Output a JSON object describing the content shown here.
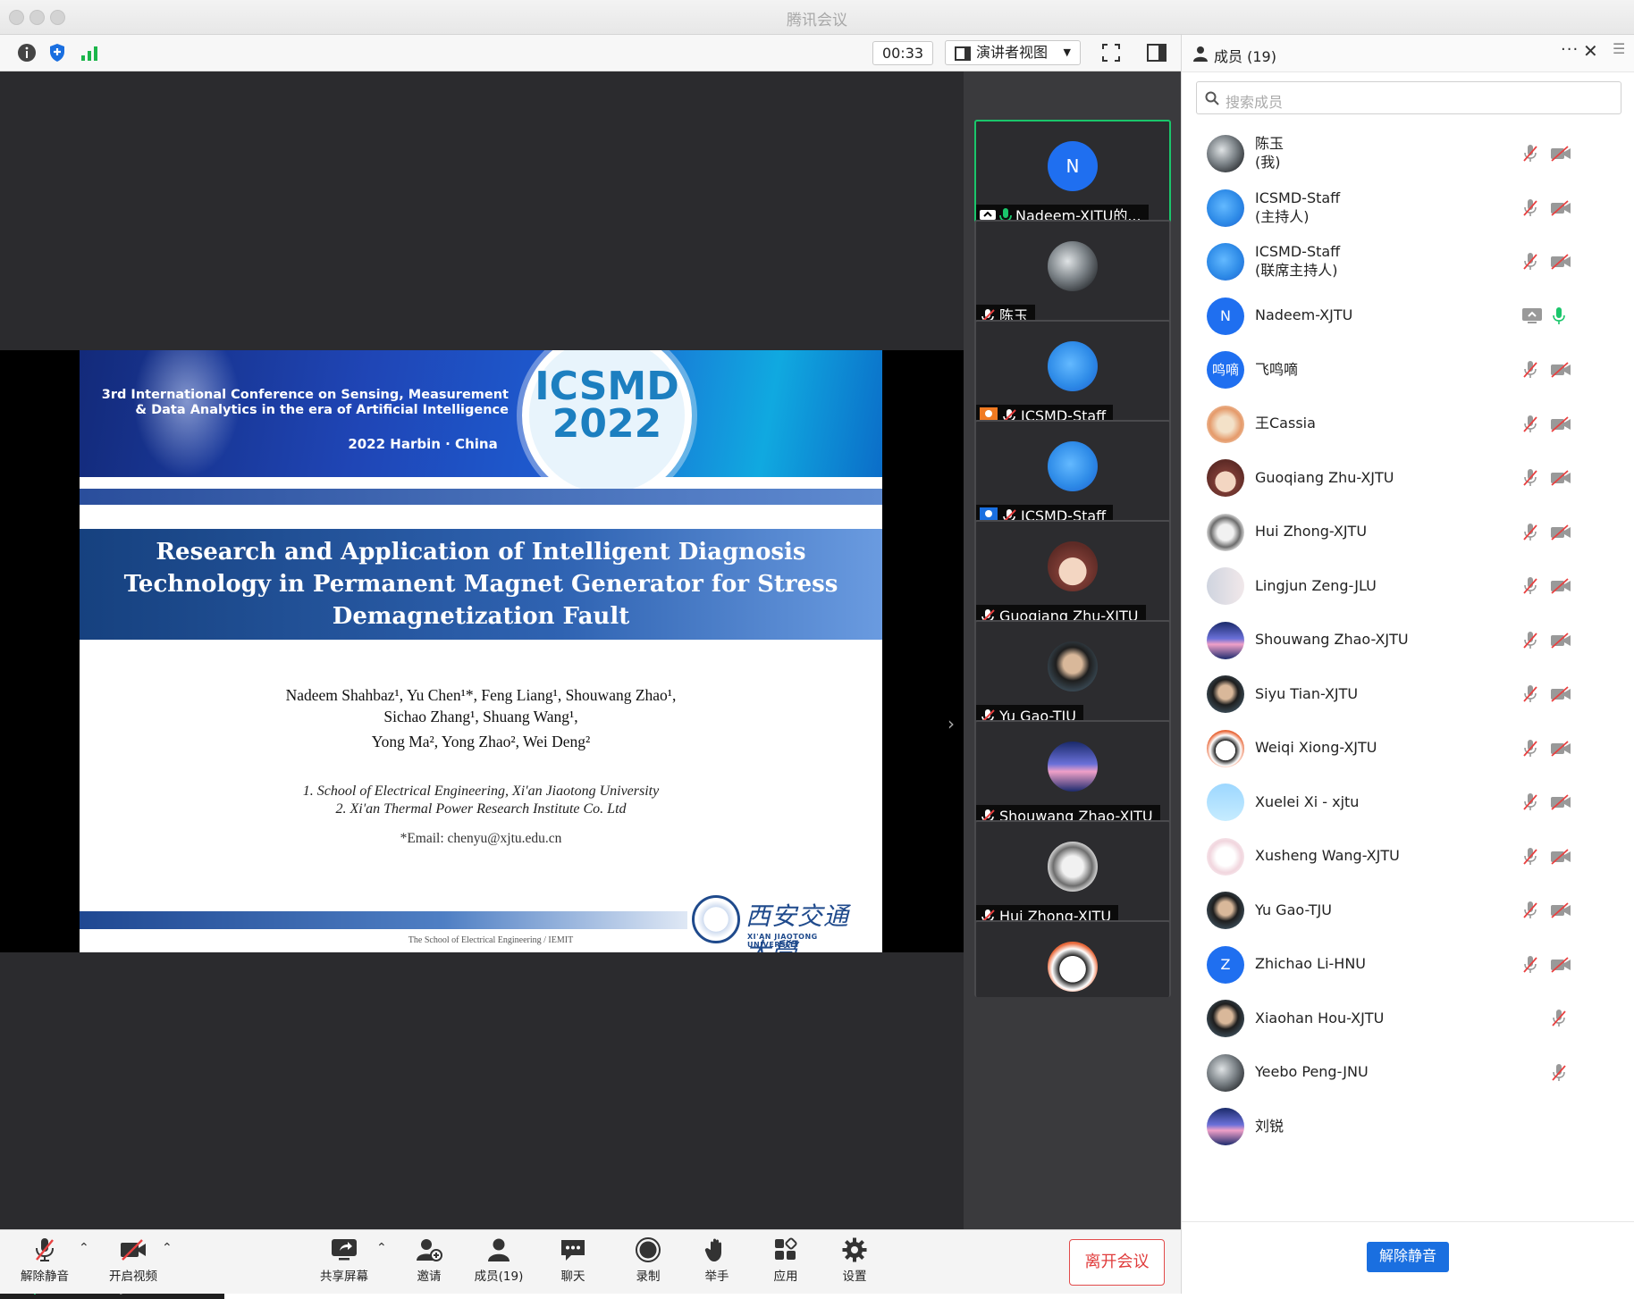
{
  "window": {
    "title": "腾讯会议"
  },
  "toolbar": {
    "timer": "00:33",
    "view_label": "演讲者视图"
  },
  "slide": {
    "conference": "3rd International Conference on Sensing, Measurement & Data Analytics in the era of Artificial Intelligence",
    "location": "2022 Harbin · China",
    "logo_line1": "ICSMD",
    "logo_line2": "2022",
    "title": "Research and Application of Intelligent Diagnosis Technology in Permanent Magnet Generator for Stress Demagnetization Fault",
    "authors_line1": "Nadeem Shahbaz¹, Yu Chen¹*, Feng Liang¹, Shouwang Zhao¹,",
    "authors_line2": "Sichao Zhang¹, Shuang Wang¹,",
    "authors_line3": "Yong Ma², Yong Zhao², Wei Deng²",
    "affil1": "1. School of Electrical Engineering, Xi'an Jiaotong University",
    "affil2": "2. Xi'an Thermal Power Research Institute Co. Ltd",
    "email": "*Email: chenyu@xjtu.edu.cn",
    "footer": "The School of Electrical Engineering / IEMIT",
    "university_cn": "西安交通大學",
    "university_en": "XI'AN JIAOTONG UNIVERSITY"
  },
  "share_label": "Nadeem-XJTU的屏幕共享",
  "tiles": [
    {
      "name": "Nadeem-XJTU的...",
      "avatar": "N"
    },
    {
      "name": "陈玉"
    },
    {
      "name": "ICSMD-Staff"
    },
    {
      "name": "ICSMD-Staff"
    },
    {
      "name": "Guoqiang Zhu-XJTU"
    },
    {
      "name": "Yu Gao-TJU"
    },
    {
      "name": "Shouwang Zhao-XJTU"
    },
    {
      "name": "Hui Zhong-XJTU"
    }
  ],
  "panel": {
    "title": "成员 (19)",
    "search_placeholder": "搜索成员",
    "unmute_label": "解除静音",
    "members": [
      {
        "name": "陈玉",
        "role": "(我)"
      },
      {
        "name": "ICSMD-Staff",
        "role": "(主持人)"
      },
      {
        "name": "ICSMD-Staff",
        "role": "(联席主持人)"
      },
      {
        "name": "Nadeem-XJTU",
        "avatar": "N"
      },
      {
        "name": "飞鸣嘀",
        "avatar": "鸣嘀"
      },
      {
        "name": "王Cassia"
      },
      {
        "name": "Guoqiang Zhu-XJTU"
      },
      {
        "name": "Hui Zhong-XJTU"
      },
      {
        "name": "Lingjun Zeng-JLU"
      },
      {
        "name": "Shouwang Zhao-XJTU"
      },
      {
        "name": "Siyu Tian-XJTU"
      },
      {
        "name": "Weiqi Xiong-XJTU"
      },
      {
        "name": "Xuelei Xi - xjtu"
      },
      {
        "name": "Xusheng Wang-XJTU"
      },
      {
        "name": "Yu Gao-TJU"
      },
      {
        "name": "Zhichao Li-HNU",
        "avatar": "Z"
      },
      {
        "name": "Xiaohan Hou-XJTU"
      },
      {
        "name": "Yeebo Peng-JNU"
      },
      {
        "name": "刘锐"
      }
    ]
  },
  "bottom": {
    "unmute": "解除静音",
    "video": "开启视频",
    "share": "共享屏幕",
    "invite": "邀请",
    "members": "成员(19)",
    "chat": "聊天",
    "record": "录制",
    "raise_hand": "举手",
    "apps": "应用",
    "settings": "设置",
    "leave": "离开会议"
  },
  "colors": {
    "accent": "#1a6fe0",
    "active_border": "#1ac66b",
    "leave": "#e03c3c"
  }
}
